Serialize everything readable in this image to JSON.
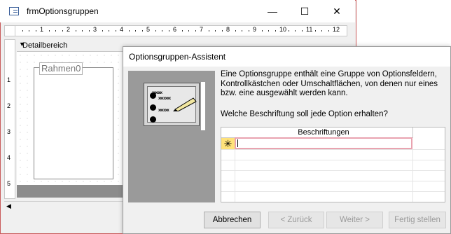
{
  "form_window": {
    "title": "frmOptionsgruppen",
    "minimize_symbol": "—",
    "maximize_symbol": "☐",
    "close_symbol": "✕",
    "ruler_numbers": [
      "1",
      "2",
      "3",
      "4",
      "5",
      "6",
      "7",
      "8",
      "9",
      "10",
      "11",
      "12"
    ],
    "vruler_numbers": [
      "1",
      "2",
      "3",
      "4",
      "5"
    ],
    "section_label": "Detailbereich",
    "frame_label": "Rahmen0"
  },
  "wizard": {
    "title": "Optionsgruppen-Assistent",
    "description": "Eine Optionsgruppe enthält eine Gruppe von Optionsfeldern, Kontrollkästchen oder Umschaltflächen, von denen nur eines bzw. eine ausgewählt werden kann.",
    "question": "Welche Beschriftung soll jede Option erhalten?",
    "grid": {
      "header": "Beschriftungen",
      "new_row_marker": "✳",
      "current_value": ""
    },
    "buttons": {
      "cancel": "Abbrechen",
      "back": "< Zurück",
      "next": "Weiter >",
      "finish": "Fertig stellen"
    }
  },
  "icons": [
    "form-icon",
    "ruler",
    "section-arrow-icon",
    "pencil-icon",
    "radio-icon",
    "new-record-star-icon",
    "scroll-left-icon"
  ],
  "colors": {
    "accent_border": "#c85a5a",
    "new_row": "#ffe27a",
    "cell_focus": "#e9a3b0"
  }
}
